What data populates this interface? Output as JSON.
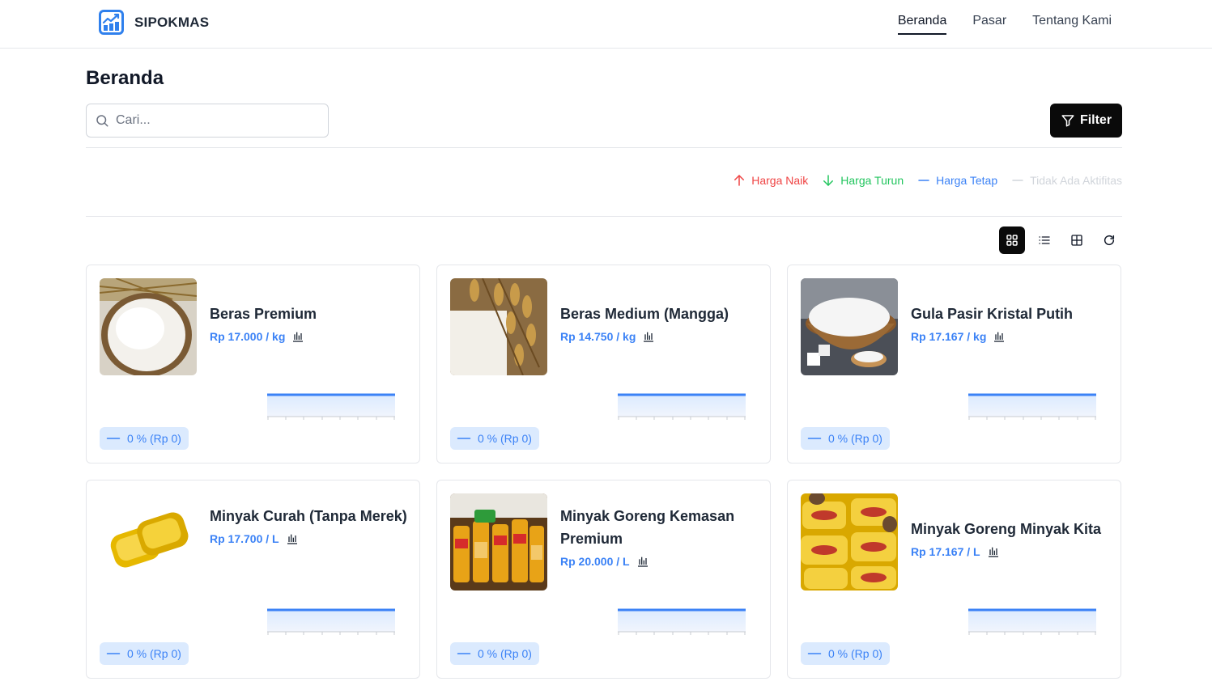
{
  "app": {
    "name": "SIPOKMAS"
  },
  "nav": {
    "items": [
      "Beranda",
      "Pasar",
      "Tentang Kami"
    ],
    "active": "Beranda"
  },
  "page": {
    "title": "Beranda"
  },
  "search": {
    "placeholder": "Cari..."
  },
  "filter": {
    "label": "Filter"
  },
  "legend": {
    "up": "Harga Naik",
    "down": "Harga Turun",
    "same": "Harga Tetap",
    "none": "Tidak Ada Aktifitas"
  },
  "colors": {
    "up": "#ef4444",
    "down": "#22c55e",
    "same": "#3b82f6",
    "none": "#d1d5db"
  },
  "view_tools": [
    "grid-view-icon",
    "list-view-icon",
    "table-view-icon",
    "refresh-icon"
  ],
  "products": [
    {
      "name": "Beras Premium",
      "price": "Rp 17.000 / kg",
      "change": "0 % (Rp 0)",
      "image": "rice-bowl"
    },
    {
      "name": "Beras Medium (Mangga)",
      "price": "Rp 14.750 / kg",
      "change": "0 % (Rp 0)",
      "image": "rice-grain"
    },
    {
      "name": "Gula Pasir Kristal Putih",
      "price": "Rp 17.167 / kg",
      "change": "0 % (Rp 0)",
      "image": "sugar-bowl"
    },
    {
      "name": "Minyak Curah (Tanpa Merek)",
      "price": "Rp 17.700 / L",
      "change": "0 % (Rp 0)",
      "image": "oil-pouch"
    },
    {
      "name": "Minyak Goreng Kemasan Premium",
      "price": "Rp 20.000 / L",
      "change": "0 % (Rp 0)",
      "image": "oil-bottles"
    },
    {
      "name": "Minyak Goreng Minyak Kita",
      "price": "Rp 17.167 / L",
      "change": "0 % (Rp 0)",
      "image": "minyakita-pouches"
    }
  ]
}
